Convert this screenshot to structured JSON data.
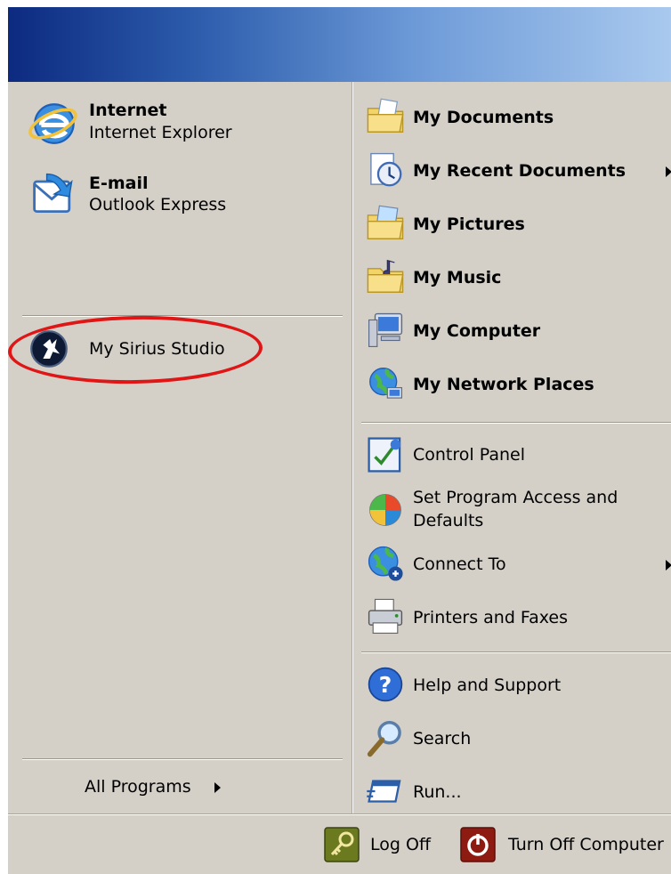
{
  "left": {
    "pinned": [
      {
        "title": "Internet",
        "subtitle": "Internet Explorer",
        "icon": "internet-explorer-icon"
      },
      {
        "title": "E-mail",
        "subtitle": "Outlook Express",
        "icon": "outlook-express-icon"
      }
    ],
    "recent": [
      {
        "label": "My Sirius Studio",
        "icon": "sirius-studio-icon"
      }
    ],
    "all_programs": "All Programs"
  },
  "right": {
    "places": [
      {
        "label": "My Documents",
        "icon": "folder-documents-icon"
      },
      {
        "label": "My Recent Documents",
        "icon": "recent-documents-icon"
      },
      {
        "label": "My Pictures",
        "icon": "folder-pictures-icon"
      },
      {
        "label": "My Music",
        "icon": "folder-music-icon"
      },
      {
        "label": "My Computer",
        "icon": "computer-icon"
      },
      {
        "label": "My Network Places",
        "icon": "network-places-icon"
      }
    ],
    "system": [
      {
        "label": "Control Panel",
        "icon": "control-panel-icon"
      },
      {
        "label": "Set Program Access and",
        "label2": "Defaults",
        "icon": "program-access-icon"
      },
      {
        "label": "Connect To",
        "icon": "connect-to-icon"
      },
      {
        "label": "Printers and Faxes",
        "icon": "printer-icon"
      }
    ],
    "tools": [
      {
        "label": "Help and Support",
        "icon": "help-icon"
      },
      {
        "label": "Search",
        "icon": "search-icon"
      },
      {
        "label": "Run...",
        "icon": "run-icon"
      }
    ]
  },
  "bottom": {
    "log_off": "Log Off",
    "turn_off": "Turn Off Computer"
  },
  "colors": {
    "menu_bg": "#d4d0c8",
    "banner_start": "#0c2a80",
    "banner_end": "#a9c9ee",
    "annotation": "#e01616"
  }
}
